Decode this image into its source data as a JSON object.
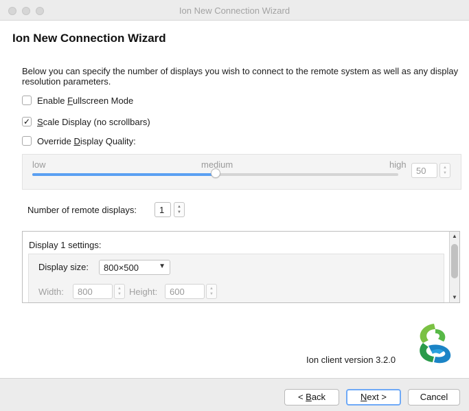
{
  "window": {
    "title": "Ion New Connection Wizard"
  },
  "wizard": {
    "heading": "Ion New Connection Wizard",
    "intro": "Below you can specify the number of displays you wish to connect to the remote system as well as any display resolution parameters."
  },
  "options": [
    {
      "pre": "Enable ",
      "key": "F",
      "post": "ullscreen Mode",
      "checked": false
    },
    {
      "pre": "",
      "key": "S",
      "post": "cale Display (no scrollbars)",
      "checked": true
    },
    {
      "pre": "Override ",
      "key": "D",
      "post": "isplay Quality:",
      "checked": false
    }
  ],
  "quality": {
    "low_label": "low",
    "medium_label": "medium",
    "high_label": "high",
    "value": "50",
    "level_percent": 50
  },
  "displays": {
    "label": "Number of remote displays:",
    "value": "1"
  },
  "display_settings": {
    "title": "Display 1 settings:",
    "size_label": "Display size:",
    "size_value": "800×500",
    "width_label": "Width:",
    "width_value": "800",
    "height_label": "Height:",
    "height_value": "600"
  },
  "footer": {
    "version": "Ion client version 3.2.0",
    "back": {
      "pre": "< ",
      "key": "B",
      "post": "ack"
    },
    "next": {
      "pre": "",
      "key": "N",
      "post": "ext >"
    },
    "cancel": "Cancel"
  },
  "colors": {
    "accent": "#5a9ff2",
    "logo_green": "#7ac143",
    "logo_blue": "#1b84c6"
  }
}
